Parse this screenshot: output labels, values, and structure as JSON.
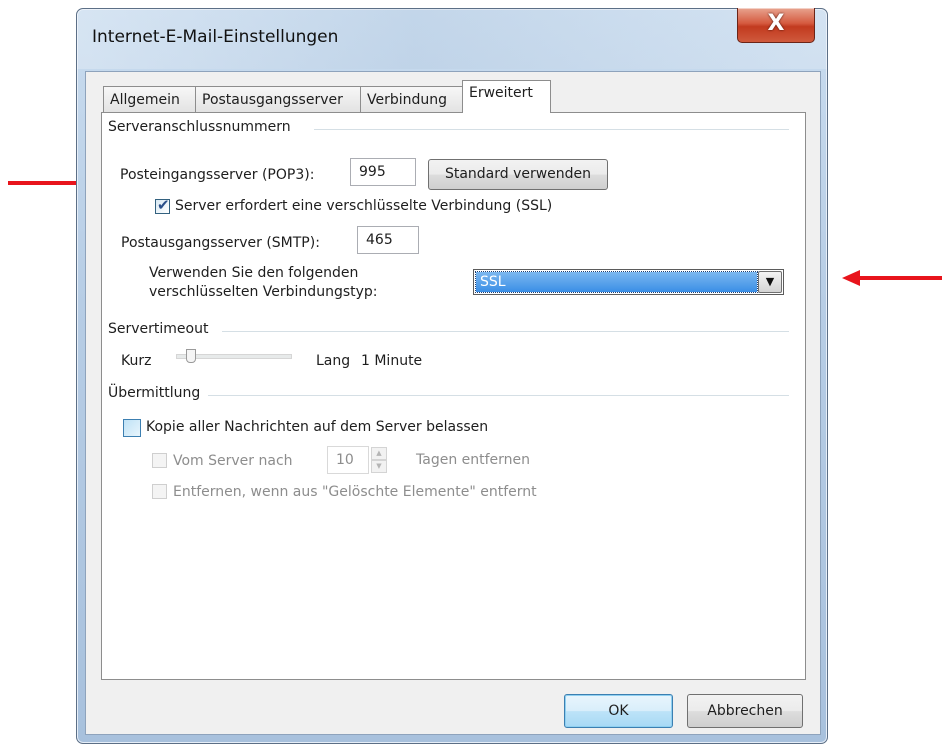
{
  "window": {
    "title": "Internet-E-Mail-Einstellungen",
    "close_glyph": "X"
  },
  "tabs": [
    {
      "label": "Allgemein",
      "active": false
    },
    {
      "label": "Postausgangsserver",
      "active": false
    },
    {
      "label": "Verbindung",
      "active": false
    },
    {
      "label": "Erweitert",
      "active": true
    }
  ],
  "ports": {
    "group_label": "Serveranschlussnummern",
    "pop3_label": "Posteingangsserver (POP3):",
    "pop3_value": "995",
    "default_button": "Standard verwenden",
    "ssl_checkbox_label": "Server erfordert eine verschlüsselte Verbindung (SSL)",
    "ssl_checked": true,
    "smtp_label": "Postausgangsserver (SMTP):",
    "smtp_value": "465",
    "encryption_label_line1": "Verwenden Sie den folgenden",
    "encryption_label_line2": "verschlüsselten Verbindungstyp:",
    "encryption_value": "SSL"
  },
  "timeout": {
    "group_label": "Servertimeout",
    "short_label": "Kurz",
    "long_label": "Lang",
    "value_label": "1 Minute",
    "level": 0.1
  },
  "delivery": {
    "group_label": "Übermittlung",
    "keep_copy_label": "Kopie aller Nachrichten auf dem Server belassen",
    "keep_copy_checked": false,
    "remove_after_label": "Vom Server nach",
    "days_value": "10",
    "days_suffix": "Tagen entfernen",
    "remove_deleted_label": "Entfernen, wenn aus \"Gelöschte Elemente\" entfernt"
  },
  "buttons": {
    "ok": "OK",
    "cancel": "Abbrechen"
  },
  "colors": {
    "annotation_arrow": "#e8141c",
    "selection": "#3a8ee6"
  }
}
